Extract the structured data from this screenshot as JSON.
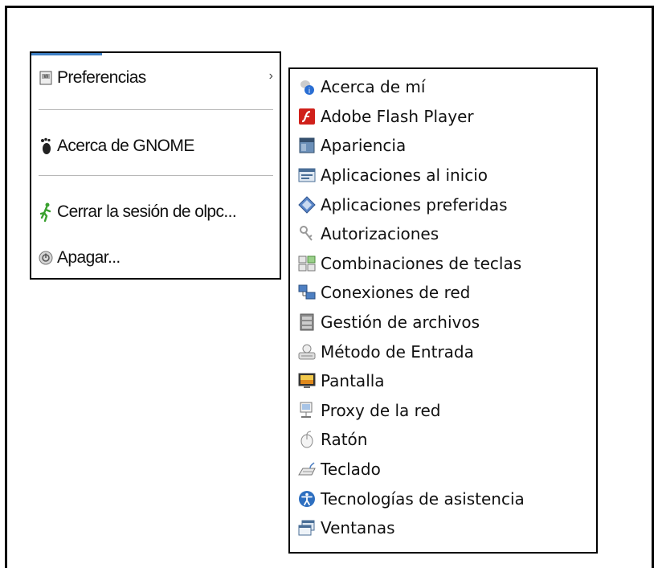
{
  "main_menu": {
    "items": [
      {
        "label": "Preferencias",
        "icon": "preferences-icon",
        "submenu_arrow": "›"
      },
      {
        "label": "Acerca de GNOME",
        "icon": "gnome-foot-icon"
      },
      {
        "label": "Cerrar la sesión de olpc...",
        "icon": "running-man-icon"
      },
      {
        "label": "Apagar...",
        "icon": "power-icon"
      }
    ]
  },
  "submenu": {
    "items": [
      {
        "label": "Acerca de mí",
        "icon": "about-me-icon"
      },
      {
        "label": "Adobe Flash Player",
        "icon": "flash-icon"
      },
      {
        "label": "Apariencia",
        "icon": "appearance-icon"
      },
      {
        "label": "Aplicaciones al inicio",
        "icon": "startup-apps-icon"
      },
      {
        "label": "Aplicaciones preferidas",
        "icon": "preferred-apps-icon"
      },
      {
        "label": "Autorizaciones",
        "icon": "keys-icon"
      },
      {
        "label": "Combinaciones de teclas",
        "icon": "keyboard-shortcuts-icon"
      },
      {
        "label": "Conexiones de red",
        "icon": "network-connections-icon"
      },
      {
        "label": "Gestión de archivos",
        "icon": "file-management-icon"
      },
      {
        "label": "Método de Entrada",
        "icon": "input-method-icon"
      },
      {
        "label": "Pantalla",
        "icon": "display-icon"
      },
      {
        "label": "Proxy de la red",
        "icon": "network-proxy-icon"
      },
      {
        "label": "Ratón",
        "icon": "mouse-icon"
      },
      {
        "label": "Teclado",
        "icon": "keyboard-icon"
      },
      {
        "label": "Tecnologías de asistencia",
        "icon": "accessibility-icon"
      },
      {
        "label": "Ventanas",
        "icon": "windows-icon"
      }
    ]
  },
  "colors": {
    "menu_accent": "#3d7fc4",
    "flash_red": "#d0201a",
    "accessibility_blue": "#2e6fc0"
  }
}
